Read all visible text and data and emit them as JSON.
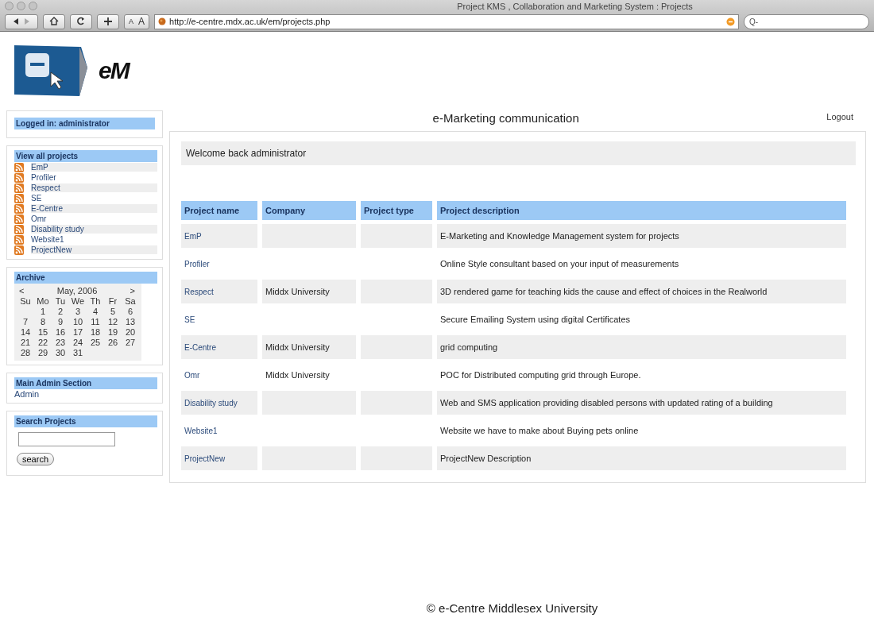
{
  "window": {
    "title": "Project KMS , Collaboration and Marketing System : Projects"
  },
  "toolbar": {
    "buttons": [
      {
        "kind": "back"
      },
      {
        "kind": "forward"
      },
      {
        "kind": "home"
      },
      {
        "kind": "reload"
      },
      {
        "kind": "add"
      }
    ],
    "text_size": [
      "A",
      "A"
    ],
    "url": "http://e-centre.mdx.ac.uk/em/projects.php",
    "search_placeholder": "Q-"
  },
  "header": {
    "logo_text": "eM",
    "title": "e-Marketing communication",
    "logout": "Logout"
  },
  "sidebar": {
    "login": "Logged in: administrator",
    "projects": {
      "heading": "View all projects",
      "items": [
        "EmP",
        "Profiler",
        "Respect",
        "SE",
        "E-Centre",
        "Omr",
        "Disability study",
        "Website1",
        "ProjectNew"
      ]
    },
    "archive": {
      "heading": "Archive",
      "prev": "<",
      "month": "May, 2006",
      "next": ">",
      "weekdays": [
        "Su",
        "Mo",
        "Tu",
        "We",
        "Th",
        "Fr",
        "Sa"
      ],
      "weeks": [
        [
          "1",
          "2",
          "3",
          "4",
          "5",
          "6"
        ],
        [
          "7",
          "8",
          "9",
          "10",
          "11",
          "12",
          "13"
        ],
        [
          "14",
          "15",
          "16",
          "17",
          "18",
          "19",
          "20"
        ],
        [
          "21",
          "22",
          "23",
          "24",
          "25",
          "26",
          "27"
        ],
        [
          "28",
          "29",
          "30",
          "31"
        ]
      ]
    },
    "admin": {
      "heading": "Main Admin Section",
      "link": "Admin"
    },
    "search": {
      "heading": "Search Projects",
      "button": "search"
    }
  },
  "welcome": "Welcome back administrator",
  "table": {
    "columns": [
      "Project name",
      "Company",
      "Project type",
      "Project description"
    ],
    "rows": [
      [
        "EmP",
        null,
        null,
        "E-Marketing and Knowledge Management system for projects"
      ],
      [
        "Profiler",
        null,
        null,
        "Online Style consultant based on your input of measurements"
      ],
      [
        "Respect",
        "Middx University",
        null,
        "3D rendered game for teaching kids the cause and effect of choices in the Realworld"
      ],
      [
        "SE",
        null,
        null,
        "Secure Emailing System using digital Certificates"
      ],
      [
        "E-Centre",
        "Middx University",
        null,
        "grid computing"
      ],
      [
        "Omr",
        "Middx University",
        null,
        "POC for Distributed computing grid through Europe."
      ],
      [
        "Disability study",
        null,
        null,
        "Web and SMS application providing disabled persons with updated rating of a building"
      ],
      [
        "Website1",
        null,
        null,
        "Website we have to make about Buying pets online"
      ],
      [
        "ProjectNew",
        null,
        null,
        "ProjectNew Description"
      ]
    ]
  },
  "footer": "© e-Centre Middlesex University"
}
